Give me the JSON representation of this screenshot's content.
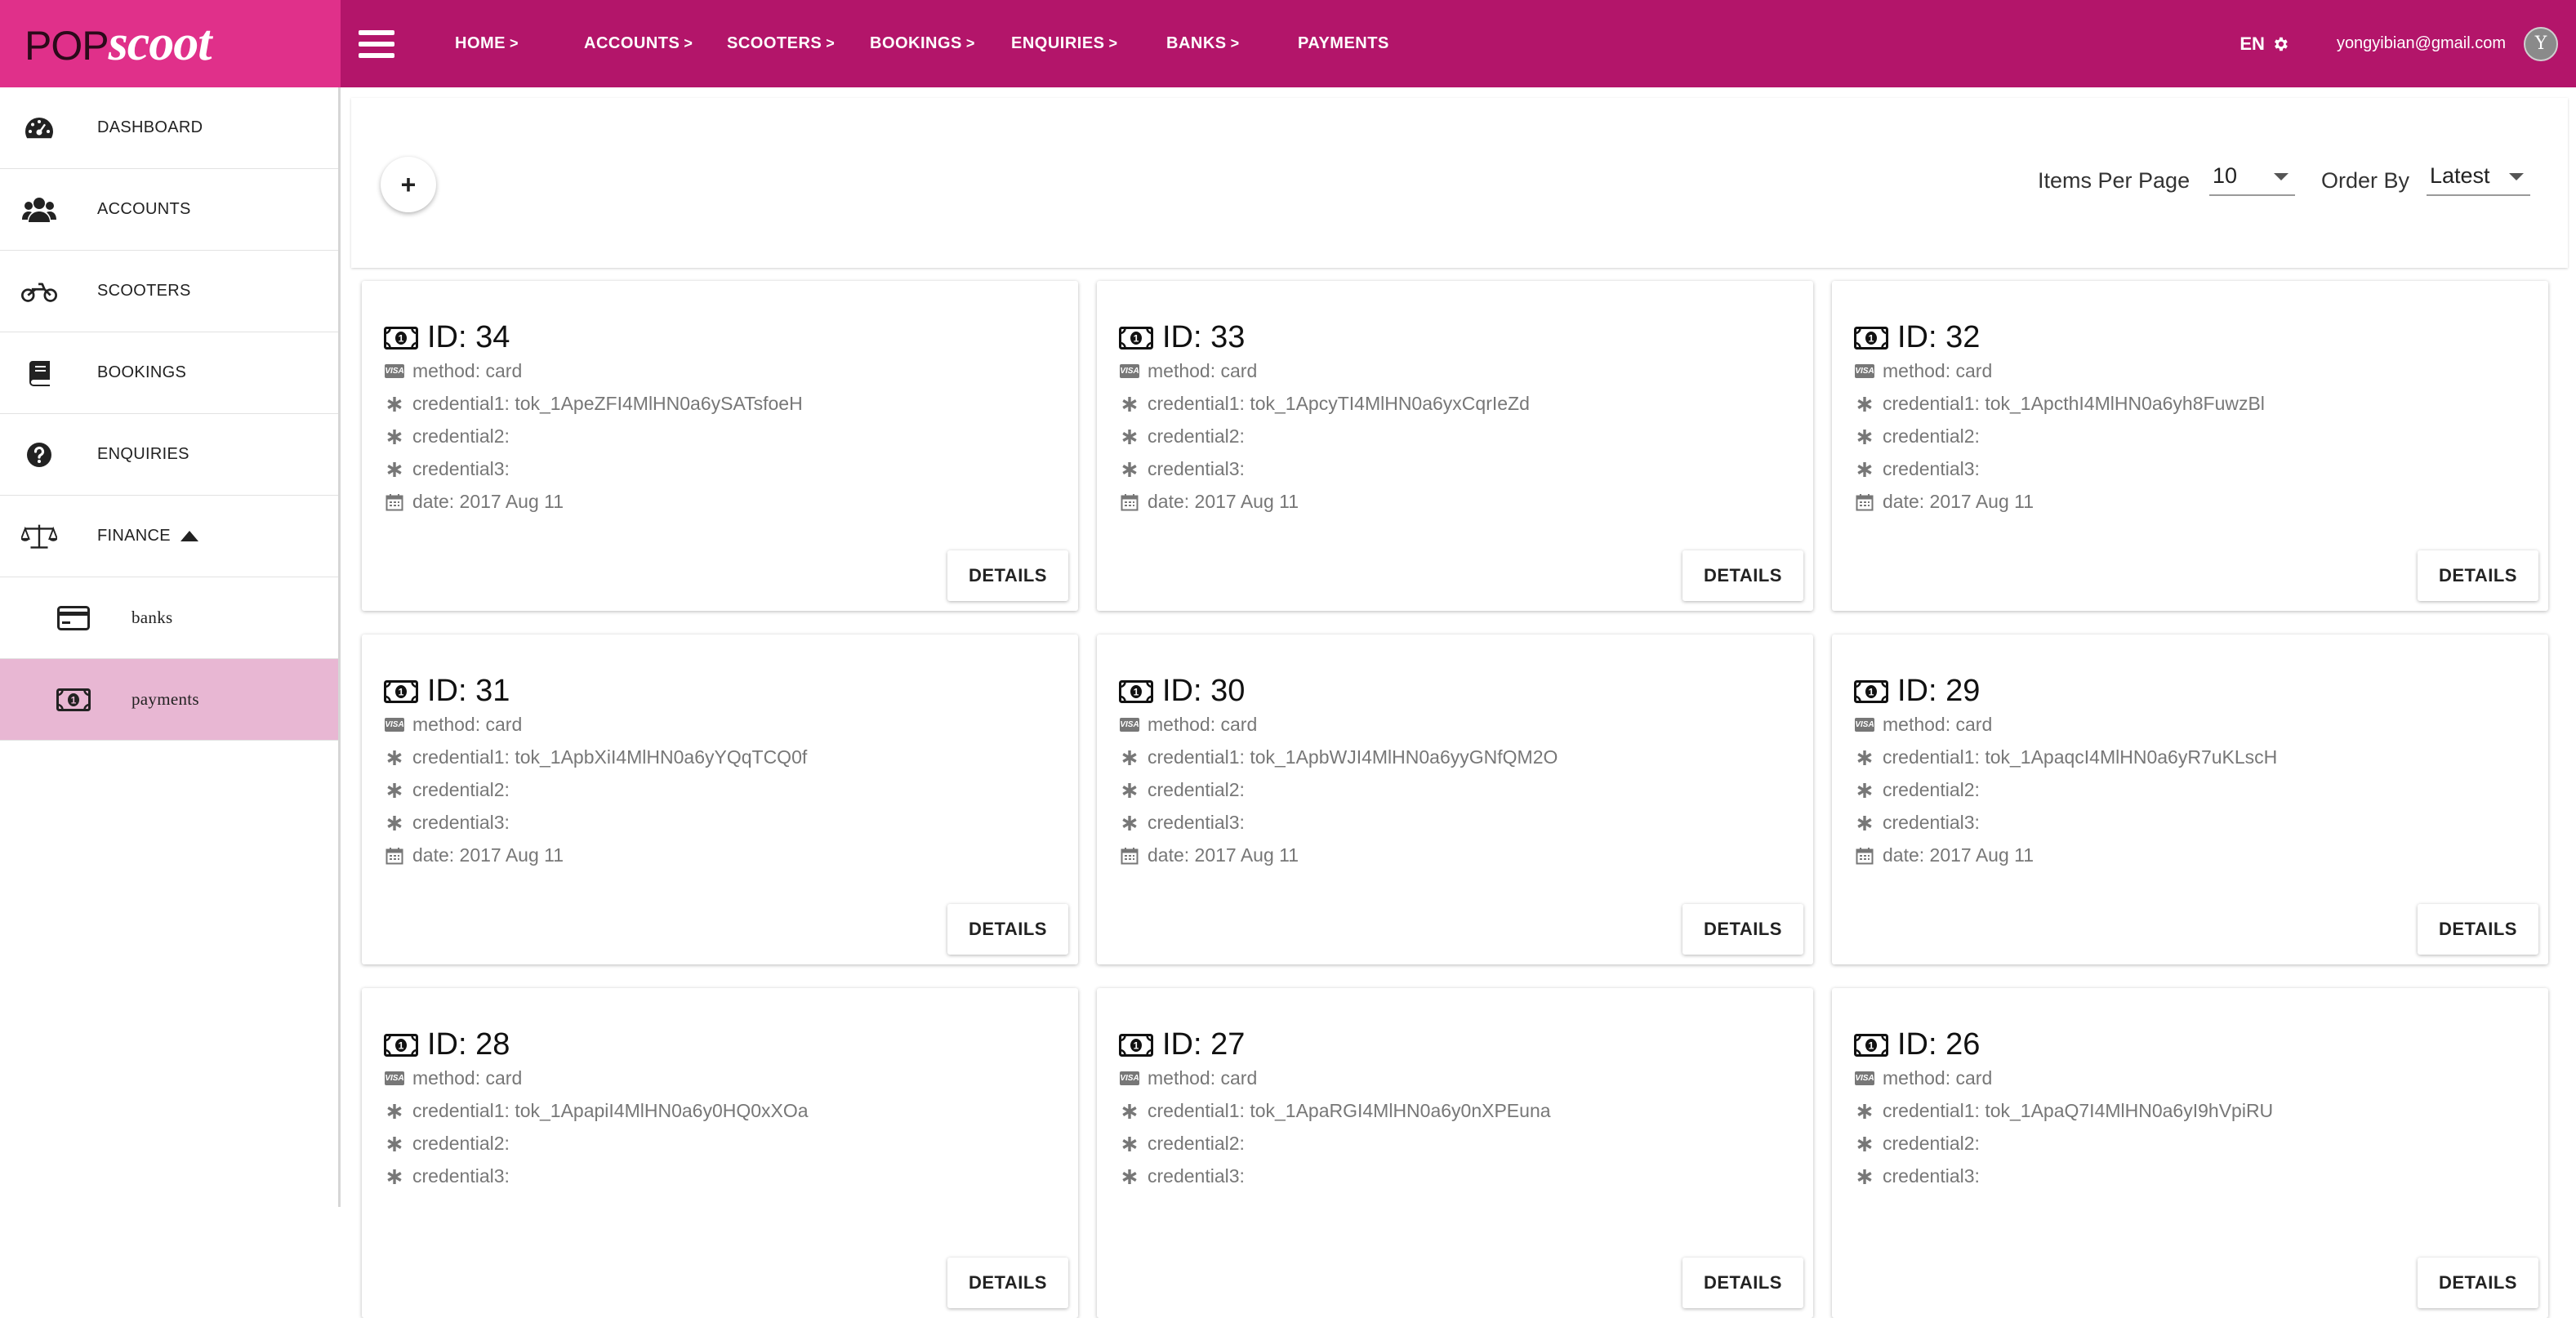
{
  "app": {
    "logo_pop": "POP",
    "logo_scoot": "scoot"
  },
  "nav": {
    "items": [
      {
        "label": "HOME",
        "chev": ">"
      },
      {
        "label": "ACCOUNTS",
        "chev": ">"
      },
      {
        "label": "SCOOTERS",
        "chev": ">"
      },
      {
        "label": "BOOKINGS",
        "chev": ">"
      },
      {
        "label": "ENQUIRIES",
        "chev": ">"
      },
      {
        "label": "BANKS",
        "chev": ">"
      },
      {
        "label": "PAYMENTS",
        "chev": ""
      }
    ],
    "lang": "EN",
    "user_email": "yongyibian@gmail.com",
    "avatar_initial": "Y"
  },
  "sidebar": {
    "items": [
      {
        "label": "DASHBOARD",
        "icon": "dashboard-icon"
      },
      {
        "label": "ACCOUNTS",
        "icon": "users-icon"
      },
      {
        "label": "SCOOTERS",
        "icon": "motorcycle-icon"
      },
      {
        "label": "BOOKINGS",
        "icon": "book-icon"
      },
      {
        "label": "ENQUIRIES",
        "icon": "question-icon"
      },
      {
        "label": "FINANCE",
        "icon": "balance-scale-icon"
      }
    ],
    "sub_items": [
      {
        "label": "banks",
        "icon": "credit-card-icon"
      },
      {
        "label": "payments",
        "icon": "money-bill-icon",
        "active": true
      }
    ]
  },
  "toolbar": {
    "add_label": "+",
    "items_per_page_label": "Items Per Page",
    "items_per_page_value": "10",
    "order_by_label": "Order By",
    "order_by_value": "Latest"
  },
  "card_labels": {
    "id_prefix": "ID: ",
    "method_prefix": "method: ",
    "credential1_prefix": "credential1: ",
    "credential2_prefix": "credential2: ",
    "credential3_prefix": "credential3: ",
    "date_prefix": "date: ",
    "details": "DETAILS",
    "visa_badge": "VISA"
  },
  "payments": [
    {
      "id": "34",
      "method": "card",
      "credential1": "tok_1ApeZFI4MlHN0a6ySATsfoeH",
      "credential2": "",
      "credential3": "",
      "date": "2017 Aug 11"
    },
    {
      "id": "33",
      "method": "card",
      "credential1": "tok_1ApcyTI4MlHN0a6yxCqrIeZd",
      "credential2": "",
      "credential3": "",
      "date": "2017 Aug 11"
    },
    {
      "id": "32",
      "method": "card",
      "credential1": "tok_1ApcthI4MlHN0a6yh8FuwzBl",
      "credential2": "",
      "credential3": "",
      "date": "2017 Aug 11"
    },
    {
      "id": "31",
      "method": "card",
      "credential1": "tok_1ApbXiI4MlHN0a6yYQqTCQ0f",
      "credential2": "",
      "credential3": "",
      "date": "2017 Aug 11"
    },
    {
      "id": "30",
      "method": "card",
      "credential1": "tok_1ApbWJI4MlHN0a6yyGNfQM2O",
      "credential2": "",
      "credential3": "",
      "date": "2017 Aug 11"
    },
    {
      "id": "29",
      "method": "card",
      "credential1": "tok_1ApaqcI4MlHN0a6yR7uKLscH",
      "credential2": "",
      "credential3": "",
      "date": "2017 Aug 11"
    },
    {
      "id": "28",
      "method": "card",
      "credential1": "tok_1ApapiI4MlHN0a6y0HQ0xXOa",
      "credential2": "",
      "credential3": "",
      "date": ""
    },
    {
      "id": "27",
      "method": "card",
      "credential1": "tok_1ApaRGI4MlHN0a6y0nXPEuna",
      "credential2": "",
      "credential3": "",
      "date": ""
    },
    {
      "id": "26",
      "method": "card",
      "credential1": "tok_1ApaQ7I4MlHN0a6yI9hVpiRU",
      "credential2": "",
      "credential3": "",
      "date": ""
    }
  ],
  "colors": {
    "brand_pink": "#e0308a",
    "brand_magenta": "#b3156a",
    "active_item": "#e8b7d3"
  }
}
